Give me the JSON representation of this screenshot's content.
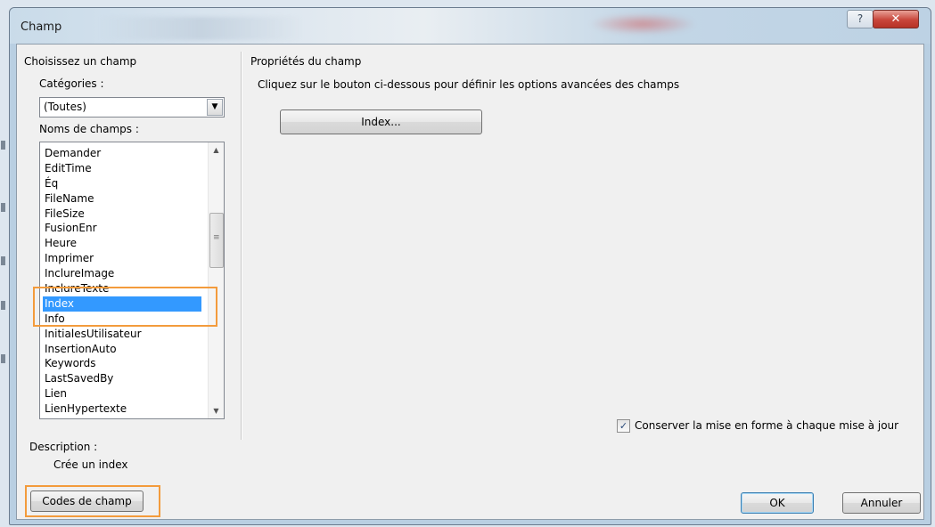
{
  "window": {
    "title": "Champ",
    "help_icon": "question-mark-icon",
    "close_icon": "close-x-icon"
  },
  "left": {
    "section_label": "Choisissez un champ",
    "categories_label": "Catégories :",
    "categories_value": "(Toutes)",
    "field_names_label": "Noms de champs :",
    "field_names": [
      "Demander",
      "EditTime",
      "Éq",
      "FileName",
      "FileSize",
      "FusionEnr",
      "Heure",
      "Imprimer",
      "InclureImage",
      "InclureTexte",
      "Index",
      "Info",
      "InitialesUtilisateur",
      "InsertionAuto",
      "Keywords",
      "LastSavedBy",
      "Lien",
      "LienHypertexte"
    ],
    "selected_field": "Index",
    "description_label": "Description :",
    "description_text": "Crée un index"
  },
  "right": {
    "section_label": "Propriétés du champ",
    "instruction": "Cliquez sur le bouton ci-dessous pour définir les options avancées des champs",
    "index_button": "Index...",
    "preserve_format_label": "Conserver la mise en forme à chaque mise à jour",
    "preserve_format_checked": true
  },
  "footer": {
    "field_codes_button": "Codes de champ",
    "ok_button": "OK",
    "cancel_button": "Annuler"
  },
  "colors": {
    "highlight_border": "#f39b3c",
    "selection": "#3399ff"
  }
}
